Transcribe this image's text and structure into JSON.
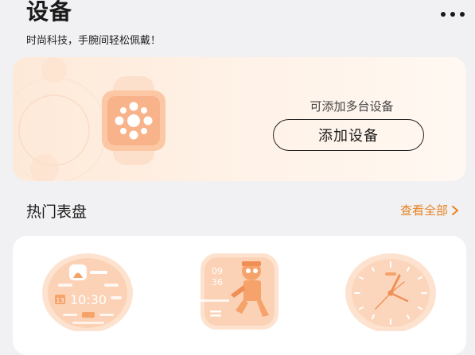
{
  "header": {
    "title": "设备",
    "subtitle": "时尚科技，手腕间轻松佩戴！",
    "more_icon": "more-horizontal-icon"
  },
  "device_card": {
    "hint": "可添加多台设备",
    "add_button_label": "添加设备",
    "illustration_icon": "smartwatch-icon"
  },
  "watch_faces": {
    "title": "热门表盘",
    "view_all_label": "查看全部",
    "faces": [
      {
        "name": "round-digital-face",
        "time": "10:30",
        "date": "13"
      },
      {
        "name": "square-character-face",
        "hour": "09",
        "minute": "36"
      },
      {
        "name": "analog-dial-face"
      }
    ]
  },
  "colors": {
    "accent": "#e8811f",
    "peach": "#fbc8a7",
    "peach_light": "#fde3cf",
    "background": "#f1f1f3"
  }
}
